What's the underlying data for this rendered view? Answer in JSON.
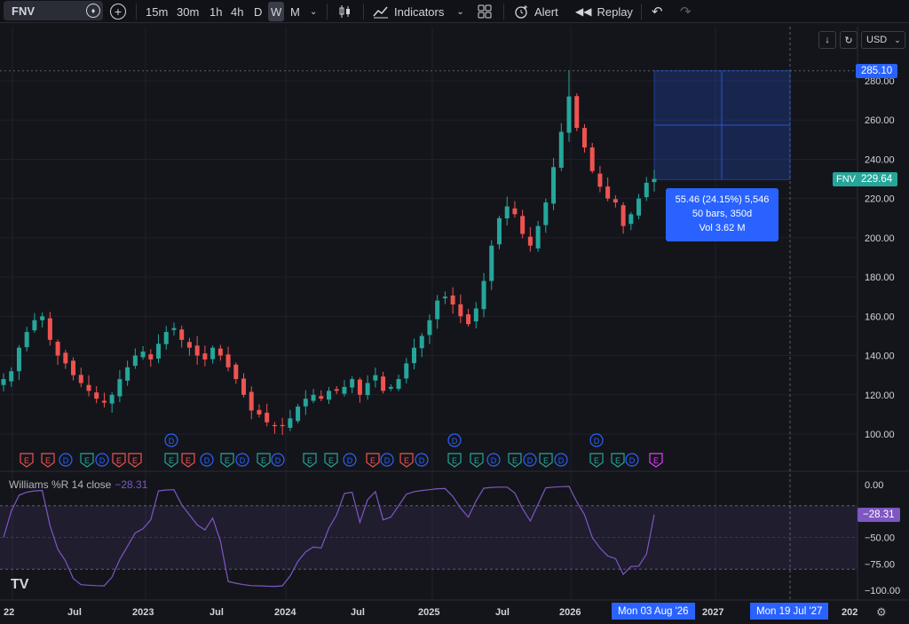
{
  "toolbar": {
    "symbol": "FNV",
    "timeframes": [
      "15m",
      "30m",
      "1h",
      "4h",
      "D",
      "W",
      "M"
    ],
    "active_timeframe": "W",
    "indicators_label": "Indicators",
    "alert_label": "Alert",
    "replay_label": "Replay"
  },
  "top_right": {
    "currency": "USD"
  },
  "price_axis": {
    "ticks": [
      "280.00",
      "260.00",
      "240.00",
      "220.00",
      "200.00",
      "180.00",
      "160.00",
      "140.00",
      "120.00",
      "100.00"
    ],
    "high_tag": "285.10",
    "last_tag_symbol": "FNV",
    "last_tag_price": "229.64"
  },
  "measure_tooltip": {
    "line1": "55.46 (24.15%) 5,546",
    "line2": "50 bars, 350d",
    "line3": "Vol 3.62 M"
  },
  "indicator": {
    "label": "Williams %R 14 close",
    "value": "−28.31",
    "tag": "−28.31",
    "ticks": [
      "0.00",
      "−25.00",
      "−50.00",
      "−75.00",
      "−100.00"
    ]
  },
  "time_axis": {
    "labels": [
      "22",
      "Jul",
      "2023",
      "Jul",
      "2024",
      "Jul",
      "2025",
      "Jul",
      "2026",
      "2027",
      "202"
    ],
    "cursor_date": "Mon 03 Aug '26",
    "range_end_date": "Mon 19 Jul '27"
  },
  "events": {
    "earnings_letter": "E",
    "dividend_letter": "D"
  },
  "colors": {
    "up": "#26a69a",
    "down": "#ef5350",
    "accent": "#2962ff",
    "williams": "#7e57c2",
    "background": "#14151b"
  },
  "chart_data": {
    "type": "candlestick",
    "price_range": [
      90,
      290
    ],
    "williams_range": [
      -100,
      0
    ],
    "closes_weekly_approx": [
      128,
      132,
      144,
      152,
      158,
      160,
      148,
      140,
      136,
      130,
      126,
      122,
      118,
      116,
      120,
      128,
      134,
      140,
      142,
      138,
      146,
      152,
      154,
      148,
      144,
      140,
      138,
      144,
      140,
      134,
      128,
      120,
      112,
      110,
      106,
      104,
      104,
      108,
      114,
      118,
      120,
      118,
      122,
      122,
      124,
      128,
      120,
      126,
      130,
      122,
      124,
      128,
      136,
      144,
      150,
      158,
      168,
      170,
      166,
      160,
      156,
      164,
      178,
      196,
      210,
      216,
      212,
      202,
      196,
      206,
      218,
      236,
      254,
      272,
      256,
      246,
      234,
      226,
      220,
      218,
      206,
      212,
      220,
      228,
      230
    ],
    "high": 285.1,
    "last": 229.64,
    "measure": {
      "change": 55.46,
      "change_pct": 24.15,
      "bars": 50,
      "days": 350,
      "volume": "3.62 M"
    }
  }
}
